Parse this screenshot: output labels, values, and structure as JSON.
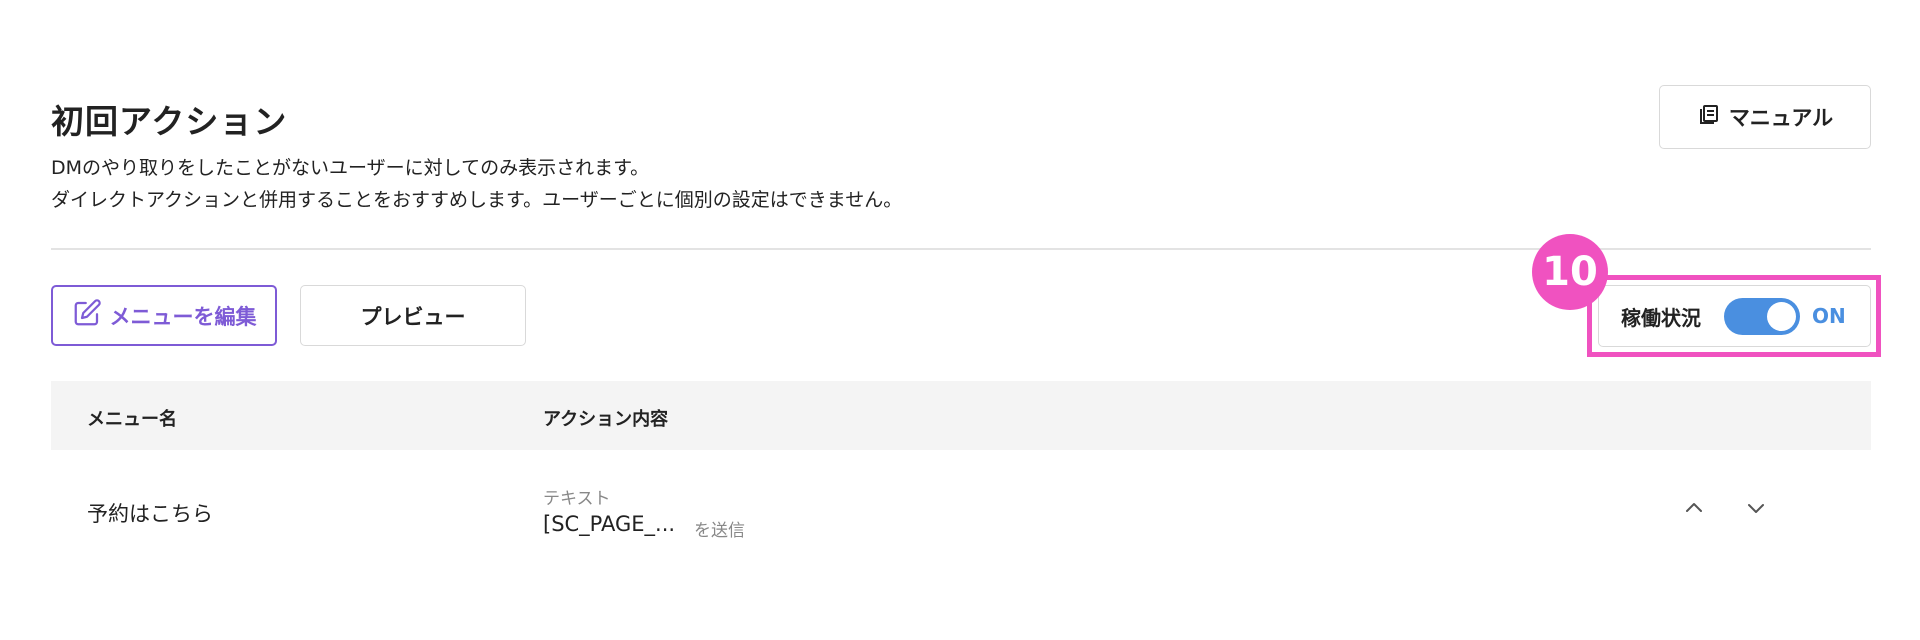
{
  "header": {
    "title": "初回アクション",
    "description_line1": "DMのやり取りをしたことがないユーザーに対してのみ表示されます。",
    "description_line2": "ダイレクトアクションと併用することをおすすめします。ユーザーごとに個別の設定はできません。",
    "manual_button": {
      "label": "マニュアル",
      "icon": "book-icon"
    }
  },
  "toolbar": {
    "edit_button": {
      "label": "メニューを編集",
      "icon": "edit-icon"
    },
    "preview_button": {
      "label": "プレビュー"
    }
  },
  "status": {
    "label": "稼働状況",
    "toggle_on": true,
    "state_text": "ON"
  },
  "annotation": {
    "step_number": "10",
    "color": "#f052c0"
  },
  "table": {
    "headers": {
      "name": "メニュー名",
      "action": "アクション内容"
    },
    "rows": [
      {
        "name": "予約はこちら",
        "action_type": "テキスト",
        "action_text": "[SC_PAGE_...",
        "action_suffix": "を送信"
      }
    ]
  },
  "colors": {
    "accent_purple": "#7e5bd6",
    "toggle_blue": "#4a8fe0",
    "highlight_pink": "#f052c0"
  }
}
